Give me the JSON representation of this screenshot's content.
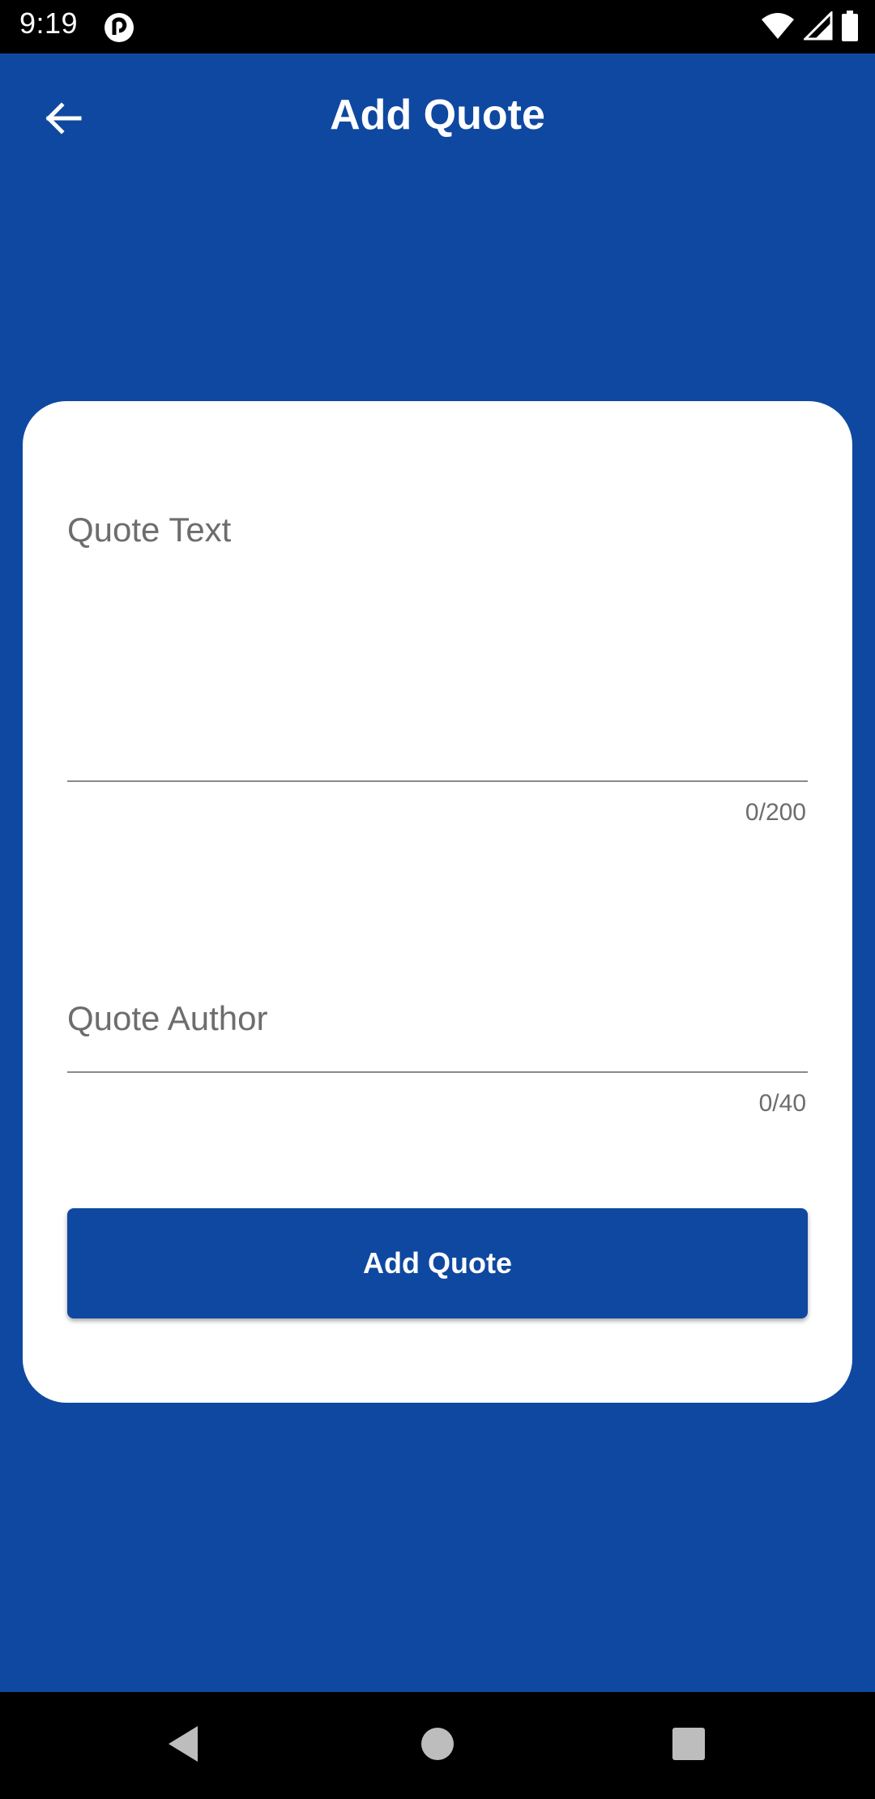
{
  "status_bar": {
    "time": "9:19",
    "app_icon": "pocket-casts-icon",
    "icons": [
      "wifi-icon",
      "signal-icon",
      "battery-icon"
    ]
  },
  "app_bar": {
    "title": "Add Quote",
    "back_icon": "back-arrow-icon"
  },
  "form": {
    "quote_text": {
      "value": "",
      "placeholder": "Quote Text",
      "counter": "0/200"
    },
    "quote_author": {
      "value": "",
      "placeholder": "Quote Author",
      "counter": "0/40"
    },
    "submit_label": "Add Quote"
  },
  "nav_bar": {
    "buttons": [
      "back-triangle-icon",
      "home-circle-icon",
      "recents-square-icon"
    ]
  },
  "colors": {
    "primary": "#0f48a0",
    "card": "#ffffff",
    "placeholder": "#6d6d6d"
  }
}
